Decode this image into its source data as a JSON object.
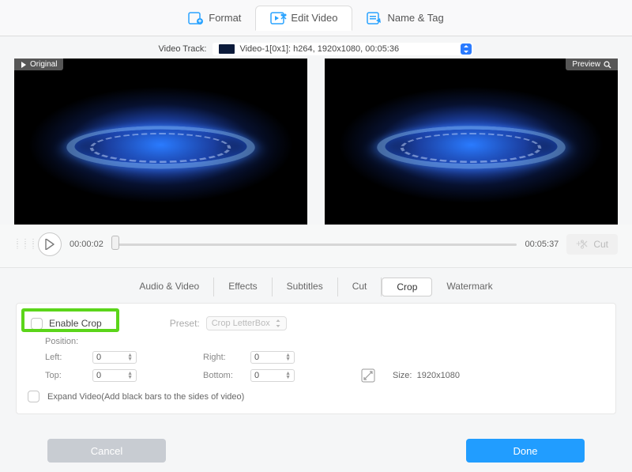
{
  "topTabs": {
    "format": "Format",
    "editVideo": "Edit Video",
    "nameTag": "Name & Tag"
  },
  "track": {
    "label": "Video Track:",
    "value": "Video-1[0x1]: h264, 1920x1080, 00:05:36"
  },
  "badges": {
    "original": "Original",
    "preview": "Preview"
  },
  "timeline": {
    "current": "00:00:02",
    "total": "00:05:37",
    "cut": "Cut"
  },
  "subTabs": {
    "audioVideo": "Audio & Video",
    "effects": "Effects",
    "subtitles": "Subtitles",
    "cut": "Cut",
    "crop": "Crop",
    "watermark": "Watermark"
  },
  "crop": {
    "enable": "Enable Crop",
    "presetLabel": "Preset:",
    "presetValue": "Crop LetterBox",
    "position": "Position:",
    "left": "Left:",
    "leftVal": "0",
    "right": "Right:",
    "rightVal": "0",
    "top": "Top:",
    "topVal": "0",
    "bottom": "Bottom:",
    "bottomVal": "0",
    "sizeLabel": "Size:",
    "sizeVal": "1920x1080",
    "expand": "Expand Video(Add black bars to the sides of video)"
  },
  "footer": {
    "cancel": "Cancel",
    "done": "Done"
  }
}
